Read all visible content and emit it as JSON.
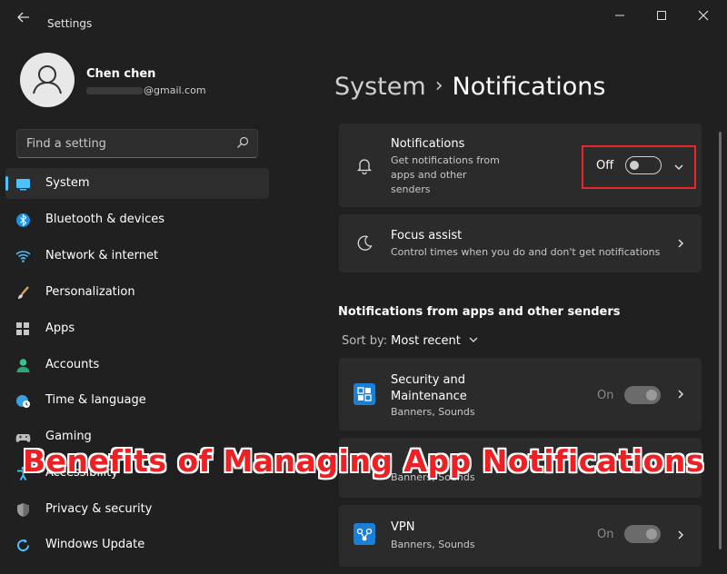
{
  "window": {
    "title": "Settings",
    "back_icon": "back-arrow-icon",
    "minimize_icon": "minimize-icon",
    "maximize_icon": "maximize-icon",
    "close_icon": "close-icon"
  },
  "profile": {
    "name": "Chen chen",
    "email_suffix": "@gmail.com"
  },
  "search": {
    "placeholder": "Find a setting"
  },
  "sidebar": {
    "items": [
      {
        "label": "System",
        "icon": "monitor-icon",
        "active": true
      },
      {
        "label": "Bluetooth & devices",
        "icon": "bluetooth-icon"
      },
      {
        "label": "Network & internet",
        "icon": "wifi-icon"
      },
      {
        "label": "Personalization",
        "icon": "brush-icon"
      },
      {
        "label": "Apps",
        "icon": "apps-icon"
      },
      {
        "label": "Accounts",
        "icon": "person-icon"
      },
      {
        "label": "Time & language",
        "icon": "globe-clock-icon"
      },
      {
        "label": "Gaming",
        "icon": "gamepad-icon"
      },
      {
        "label": "Accessibility",
        "icon": "accessibility-icon"
      },
      {
        "label": "Privacy & security",
        "icon": "shield-icon"
      },
      {
        "label": "Windows Update",
        "icon": "update-icon"
      }
    ]
  },
  "breadcrumb": {
    "parent": "System",
    "separator": "›",
    "current": "Notifications"
  },
  "notifications_card": {
    "title": "Notifications",
    "description": "Get notifications from apps and other senders",
    "desc_line1": "Get notifications from",
    "desc_line2": "apps and other",
    "desc_line3": "senders",
    "toggle_label": "Off",
    "toggle_state": "off",
    "icon": "bell-icon"
  },
  "focus_card": {
    "title": "Focus assist",
    "description": "Control times when you do and don't get notifications",
    "icon": "moon-icon"
  },
  "apps_section": {
    "title": "Notifications from apps and other senders",
    "sort_label": "Sort by:",
    "sort_value": "Most recent",
    "apps": [
      {
        "name_line1": "Security and",
        "name_line2": "Maintenance",
        "detail": "Banners, Sounds",
        "toggle_label": "On",
        "icon": "security-maintenance-icon"
      },
      {
        "name_line1": "",
        "detail": "Banners, Sounds",
        "icon": "app-icon"
      },
      {
        "name_line1": "VPN",
        "detail": "Banners, Sounds",
        "toggle_label": "On",
        "icon": "vpn-icon"
      }
    ]
  },
  "overlay": {
    "caption": "Benefits of Managing App Notifications"
  },
  "colors": {
    "background": "#202020",
    "card": "#2b2b2b",
    "accent": "#4cc2ff",
    "highlight": "#e8262c",
    "overlay_text": "#ed2024"
  }
}
